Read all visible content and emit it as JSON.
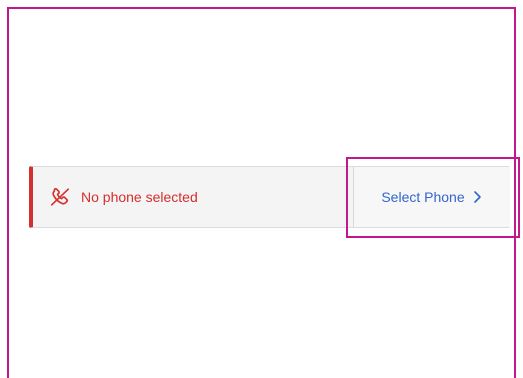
{
  "phone_status": {
    "icon": "phone-disabled-icon",
    "message": "No phone selected",
    "color": "#d32f2f"
  },
  "select_phone": {
    "label": "Select Phone",
    "icon": "chevron-right-icon",
    "color": "#3366cc"
  },
  "highlight_color": "#c2188b"
}
